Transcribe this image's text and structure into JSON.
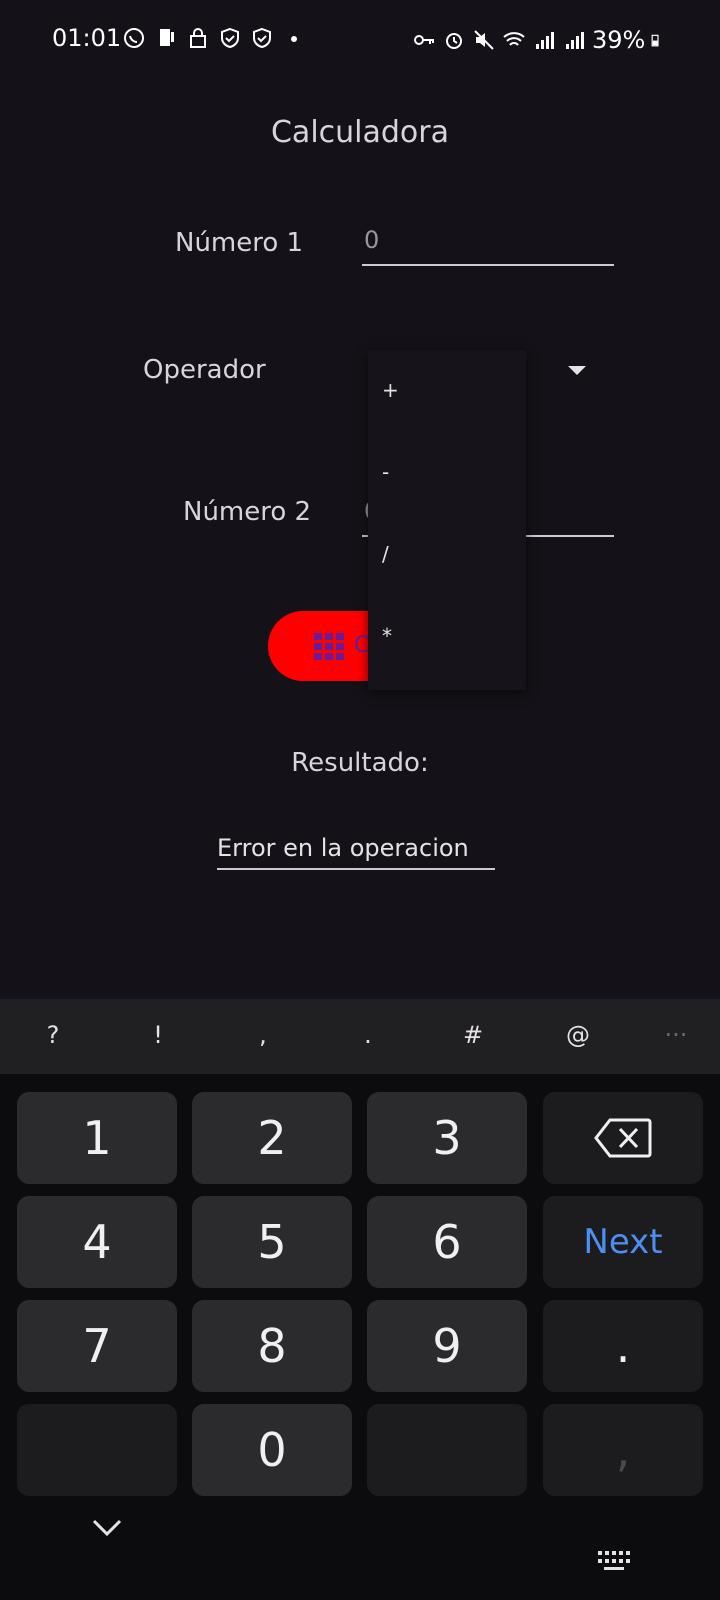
{
  "status_bar": {
    "time": "01:01",
    "battery": "39%",
    "left_icons": [
      "whatsapp-icon",
      "phone-icon",
      "lock-icon",
      "shield-icon",
      "shield-icon",
      "dot-icon"
    ],
    "right_icons": [
      "key-icon",
      "alarm-icon",
      "mute-icon",
      "wifi-icon",
      "signal-icon",
      "signal-icon",
      "battery-icon"
    ]
  },
  "app": {
    "title": "Calculadora",
    "numero1": {
      "label": "Número 1",
      "value": "0"
    },
    "operador": {
      "label": "Operador",
      "options": [
        "+",
        "-",
        "/",
        "*"
      ]
    },
    "numero2": {
      "label": "Número 2",
      "value": "0"
    },
    "calc_button_icon": "grid-icon",
    "calc_button_partial": "C",
    "result_label": "Resultado:",
    "result_value": "Error en la operacion"
  },
  "keyboard": {
    "symbols": [
      "?",
      "!",
      ",",
      ".",
      "#",
      "@",
      "···"
    ],
    "rows": [
      [
        "1",
        "2",
        "3",
        "backspace"
      ],
      [
        "4",
        "5",
        "6",
        "Next"
      ],
      [
        "7",
        "8",
        "9",
        "."
      ],
      [
        "",
        "0",
        "",
        ","
      ]
    ]
  },
  "colors": {
    "background": "#141218",
    "accent_red": "#ff0000",
    "next_blue": "#4c8ef2"
  }
}
